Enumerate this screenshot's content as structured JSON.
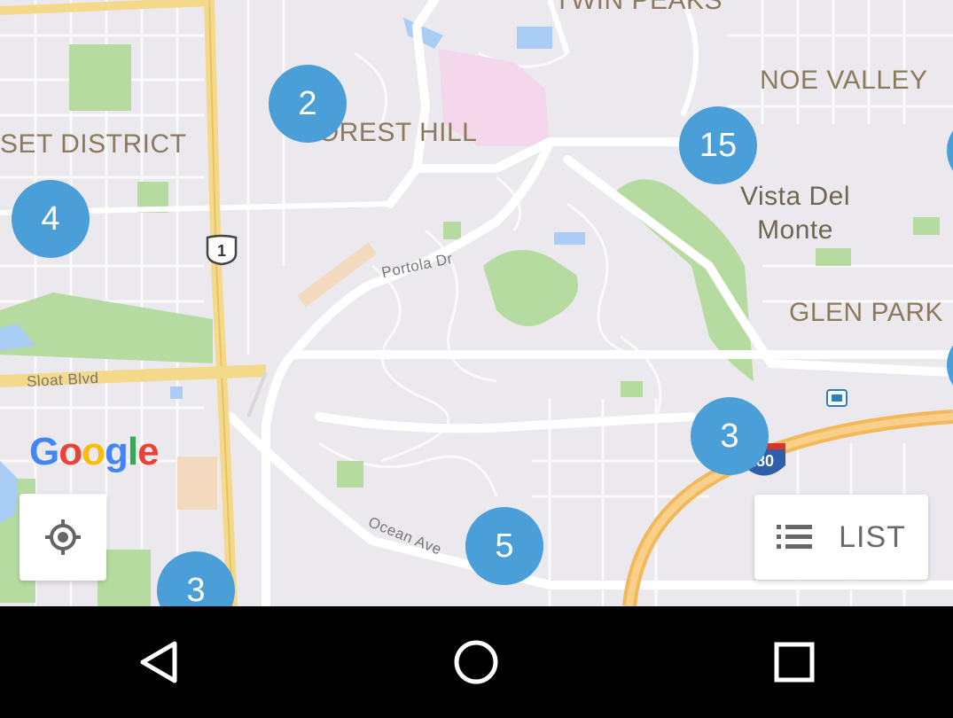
{
  "map": {
    "districts": {
      "twin_peaks": "TWIN PEAKS",
      "noe_valley": "NOE VALLEY",
      "forest_hill": "FOREST HILL",
      "sunset_district": "SET DISTRICT",
      "glen_park": "GLEN PARK",
      "vista_del_monte_1": "Vista Del",
      "vista_del_monte_2": "Monte"
    },
    "streets": {
      "portola": "Portola Dr",
      "sloat": "Sloat Blvd",
      "ocean": "Ocean Ave"
    },
    "highway_shield": "1",
    "interstate_shield": "280",
    "clusters": {
      "forest_hill": "2",
      "noe": "15",
      "sunset": "4",
      "glen": "3",
      "ocean": "5",
      "sw": "3"
    },
    "colors": {
      "cluster": "#4a9fd8",
      "park": "#b6dba0",
      "road": "#ffffff",
      "highway": "#f5d98a",
      "water": "#a9cdf4"
    }
  },
  "controls": {
    "list_label": "LIST",
    "locate_icon": "my-location-icon",
    "list_icon": "list-icon"
  },
  "brand": {
    "logo": [
      "G",
      "o",
      "o",
      "g",
      "l",
      "e"
    ]
  },
  "navbar": {
    "back_icon": "back-triangle-icon",
    "home_icon": "home-circle-icon",
    "recents_icon": "recents-square-icon"
  }
}
